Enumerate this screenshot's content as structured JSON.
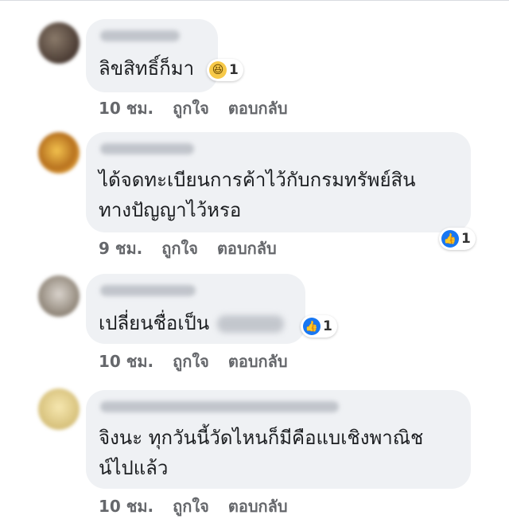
{
  "actions": {
    "like_label": "ถูกใจ",
    "reply_label": "ตอบกลับ"
  },
  "colors": {
    "bubble_bg": "#eff1f4",
    "meta_text": "#65676b",
    "like_blue": "#1877f2"
  },
  "comments": [
    {
      "text_lines": [
        "ลิขสิทธิ์ก็มา"
      ],
      "time": "10 ชม.",
      "reaction": {
        "icon": "haha-emoji-icon",
        "count": "1"
      }
    },
    {
      "text_lines": [
        "ได้จดทะเบียนการค้าไว้กับกรมทรัพย์สิน",
        "ทางปัญญาไว้หรอ"
      ],
      "time": "9 ชม.",
      "reaction": {
        "icon": "like-thumb-icon",
        "count": "1"
      }
    },
    {
      "text_lines": [
        "เปลี่ยนชื่อเป็น"
      ],
      "time": "10 ชม.",
      "reaction": {
        "icon": "like-thumb-icon",
        "count": "1"
      }
    },
    {
      "text_lines": [
        "จิงนะ ทุกวันนี้วัดไหนก็มีคือแบเชิงพาณิช",
        "น์ไปแล้ว"
      ],
      "time": "10 ชม."
    }
  ]
}
